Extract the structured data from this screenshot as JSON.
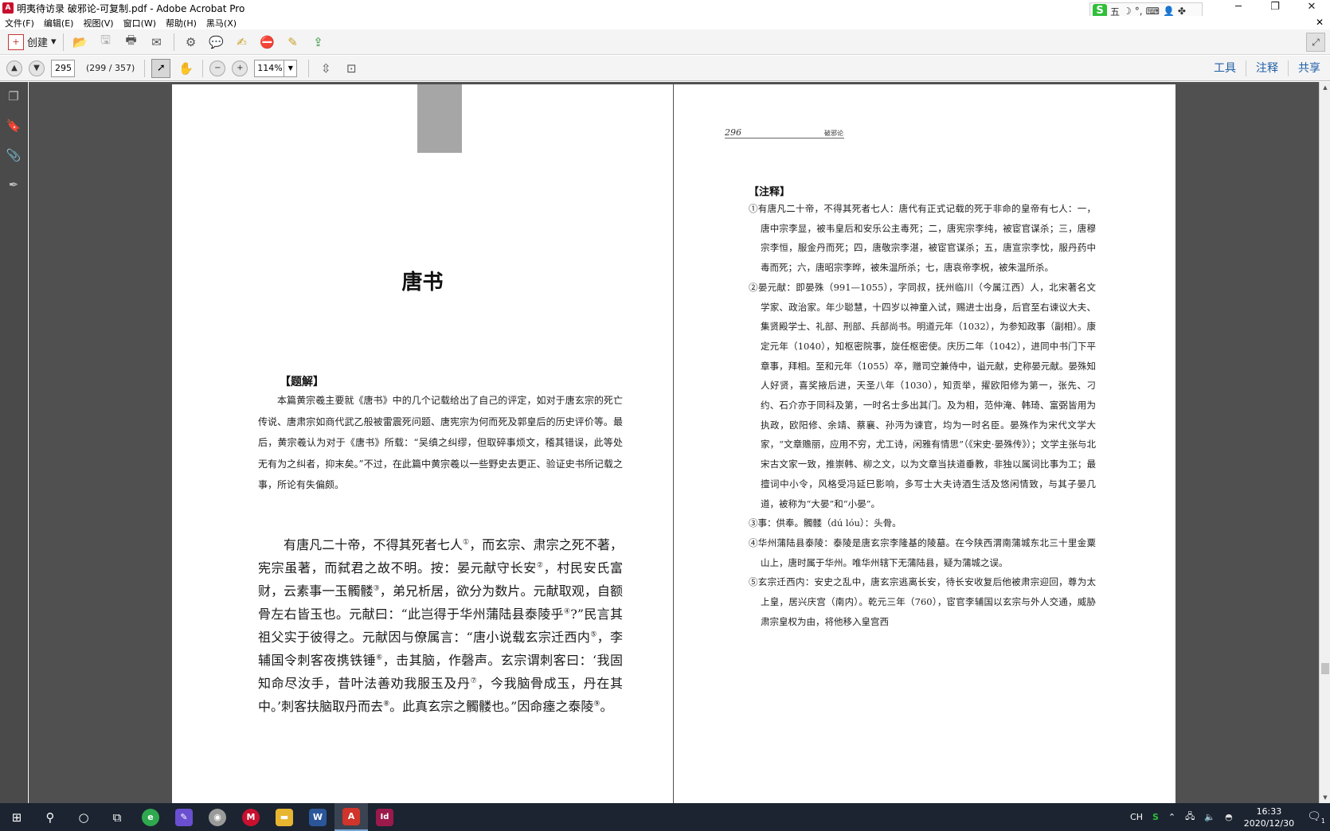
{
  "window": {
    "title": "明夷待访录  破邪论-可复制.pdf - Adobe Acrobat Pro",
    "app_icon": "acrobat-icon",
    "controls": [
      "─",
      "❐",
      "✕"
    ]
  },
  "menu": {
    "items": [
      "文件(F)",
      "编辑(E)",
      "视图(V)",
      "窗口(W)",
      "帮助(H)",
      "黑马(X)"
    ],
    "close": "✕"
  },
  "ime": {
    "logo": "S",
    "mode": "五",
    "icons": [
      "☽",
      "°,",
      "⌨",
      "👤",
      "✤"
    ]
  },
  "toolbar": {
    "create_label": "创建",
    "create_dropdown": "▾"
  },
  "nav": {
    "page_input": "295",
    "page_count": "(299 / 357)",
    "zoom": "114%",
    "panes": [
      "工具",
      "注释",
      "共享"
    ]
  },
  "left_page": {
    "title": "唐书",
    "tijie_label": "【题解】",
    "tijie_text": "本篇黄宗羲主要就《唐书》中的几个记载给出了自己的评定，如对于唐玄宗的死亡传说、唐肃宗如商代武乙般被雷震死问题、唐宪宗为何而死及郭皇后的历史评价等。最后，黄宗羲认为对于《唐书》所载：“吴缜之纠缪，但取碎事烦文，稽其错误，此等处无有为之纠者，抑末矣。”不过，在此篇中黄宗羲以一些野史去更正、验证史书所记载之事，所论有失偏颇。",
    "main_segments": [
      "有唐凡二十帝，不得其死者七人",
      "①",
      "，而玄宗、肃宗之死不著，宪宗虽著，而弑君之故不明。按：晏元献守长安",
      "②",
      "，村民安氏富财，云素事一玉髑髅",
      "③",
      "，弟兄析居，欲分为数片。元献取观，自额骨左右皆玉也。元献曰：“此岂得于华州蒲陆县泰陵乎",
      "④",
      "?”民言其祖父实于彼得之。元献因与僚属言：“唐小说载玄宗迁西内",
      "⑤",
      "，李辅国令刺客夜携铁锤",
      "⑥",
      "，击其脑，作磬声。玄宗谓刺客曰：‘我固知命尽汝手，昔叶法善劝我服玉及丹",
      "⑦",
      "，今我脑骨成玉，丹在其中。’刺客扶脑取丹而去",
      "⑧",
      "。此真玄宗之髑髅也。”因命瘗之泰陵",
      "⑨",
      "。"
    ]
  },
  "right_page": {
    "page_number": "296",
    "running_title": "破邪论",
    "notes_label": "【注释】",
    "notes": [
      "①有唐凡二十帝，不得其死者七人：唐代有正式记载的死于非命的皇帝有七人：一，唐中宗李显，被韦皇后和安乐公主毒死；二，唐宪宗李纯，被宦官谋杀；三，唐穆宗李恒，服金丹而死；四，唐敬宗李湛，被宦官谋杀；五，唐宣宗李忱，服丹药中毒而死；六，唐昭宗李晔，被朱温所杀；七，唐哀帝李柷，被朱温所杀。",
      "②晏元献：即晏殊（991—1055），字同叔，抚州临川（今属江西）人，北宋著名文学家、政治家。年少聪慧，十四岁以神童入试，赐进士出身，后官至右谏议大夫、集贤殿学士、礼部、刑部、兵部尚书。明道元年（1032），为参知政事（副相）。康定元年（1040），知枢密院事，旋任枢密使。庆历二年（1042），进同中书门下平章事，拜相。至和元年（1055）卒，赠司空兼侍中，谥元献，史称晏元献。晏殊知人好贤，喜奖掖后进，天圣八年（1030），知贡举，擢欧阳修为第一，张先、刁约、石介亦于同科及第，一时名士多出其门。及为相，范仲淹、韩琦、富弼皆用为执政，欧阳修、余靖、蔡襄、孙沔为谏官，均为一时名臣。晏殊作为宋代文学大家，“文章赡丽，应用不穷，尤工诗，闲雅有情思”（《宋史·晏殊传》）；文学主张与北宋古文家一致，推崇韩、柳之文，以为文章当扶道垂教，非独以属词比事为工；最擅词中小令，风格受冯延巳影响，多写士大夫诗酒生活及悠闲情致，与其子晏几道，被称为“大晏”和“小晏”。",
      "③事：供奉。髑髅（dú lóu）：头骨。",
      "④华州蒲陆县泰陵：泰陵是唐玄宗李隆基的陵墓。在今陕西渭南蒲城东北三十里金粟山上，唐时属于华州。唯华州辖下无蒲陆县，疑为蒲城之误。",
      "⑤玄宗迁西内：安史之乱中，唐玄宗逃离长安，待长安收复后他被肃宗迎回，尊为太上皇，居兴庆宫（南内）。乾元三年（760），宦官李辅国以玄宗与外人交通，威胁肃宗皇权为由，将他移入皇宫西"
    ]
  },
  "taskbar": {
    "apps": [
      {
        "name": "start-icon",
        "glyph": "⊞"
      },
      {
        "name": "search-icon",
        "glyph": "⚲"
      },
      {
        "name": "cortana-icon",
        "glyph": "○"
      },
      {
        "name": "task-view-icon",
        "glyph": "⧉"
      },
      {
        "name": "browser-app-icon",
        "glyph": "e",
        "color": "#2fa84f"
      },
      {
        "name": "design-app-icon",
        "glyph": "✎",
        "color": "#6a4fd1"
      },
      {
        "name": "disc-app-icon",
        "glyph": "◉",
        "color": "#9a9a9a"
      },
      {
        "name": "media-app-icon",
        "glyph": "M",
        "color": "#c8102e"
      },
      {
        "name": "file-explorer-icon",
        "glyph": "▬",
        "color": "#e8b531"
      },
      {
        "name": "word-app-icon",
        "glyph": "W",
        "color": "#2b579a"
      },
      {
        "name": "acrobat-app-icon",
        "glyph": "A",
        "color": "#d1342a"
      },
      {
        "name": "indesign-app-icon",
        "glyph": "Id",
        "color": "#9b1a4b"
      }
    ],
    "tray": {
      "ime_label": "CH",
      "time": "16:33",
      "date": "2020/12/30",
      "notification_badge": "1"
    }
  }
}
